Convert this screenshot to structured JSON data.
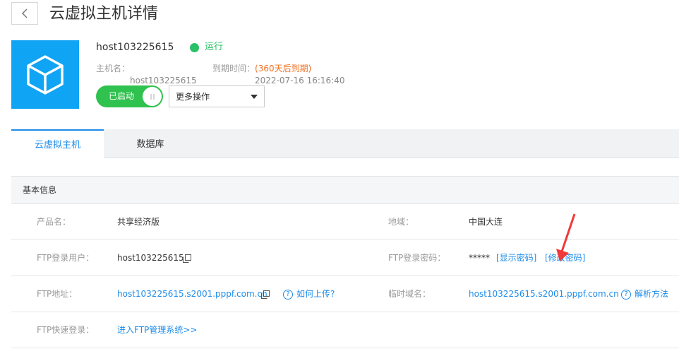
{
  "header": {
    "back_icon": "chevron-left-icon",
    "title": "云虚拟主机详情"
  },
  "host": {
    "name": "host103225615",
    "status": "运行",
    "status_color": "#29c067",
    "hostname_label": "主机名：",
    "hostname_value": "host103225615",
    "expire_label": "到期时间：",
    "expire_value": "2022-07-16 16:16:40",
    "expire_remaining": "(360天后到期)",
    "icon": "cube-icon"
  },
  "actions": {
    "toggle_label": "已启动",
    "more_label": "更多操作"
  },
  "tabs": [
    {
      "label": "云虚拟主机",
      "active": true
    },
    {
      "label": "数据库",
      "active": false
    }
  ],
  "section": {
    "title": "基本信息"
  },
  "info": {
    "product_label": "产品名：",
    "product_value": "共享经济版",
    "region_label": "地域：",
    "region_value": "中国大连",
    "ftp_user_label": "FTP登录用户：",
    "ftp_user_value": "host103225615",
    "ftp_pwd_label": "FTP登录密码：",
    "ftp_pwd_value": "*****",
    "show_pwd": "[显示密码]",
    "change_pwd": "[修改密码]",
    "ftp_addr_label": "FTP地址：",
    "ftp_addr_value": "host103225615.s2001.pppf.com.cn",
    "how_upload": "如何上传?",
    "temp_domain_label": "临时域名：",
    "temp_domain_value": "host103225615.s2001.pppf.com.cn",
    "resolve_method": "解析方法",
    "ftp_quick_label": "FTP快速登录：",
    "ftp_quick_link": "进入FTP管理系统>>"
  },
  "colors": {
    "accent": "#1e8ce8",
    "toggle_on": "#2fc24e",
    "warning": "#f06f20",
    "icon_bg": "#10a4f4",
    "annotation": "#f03a3a"
  }
}
